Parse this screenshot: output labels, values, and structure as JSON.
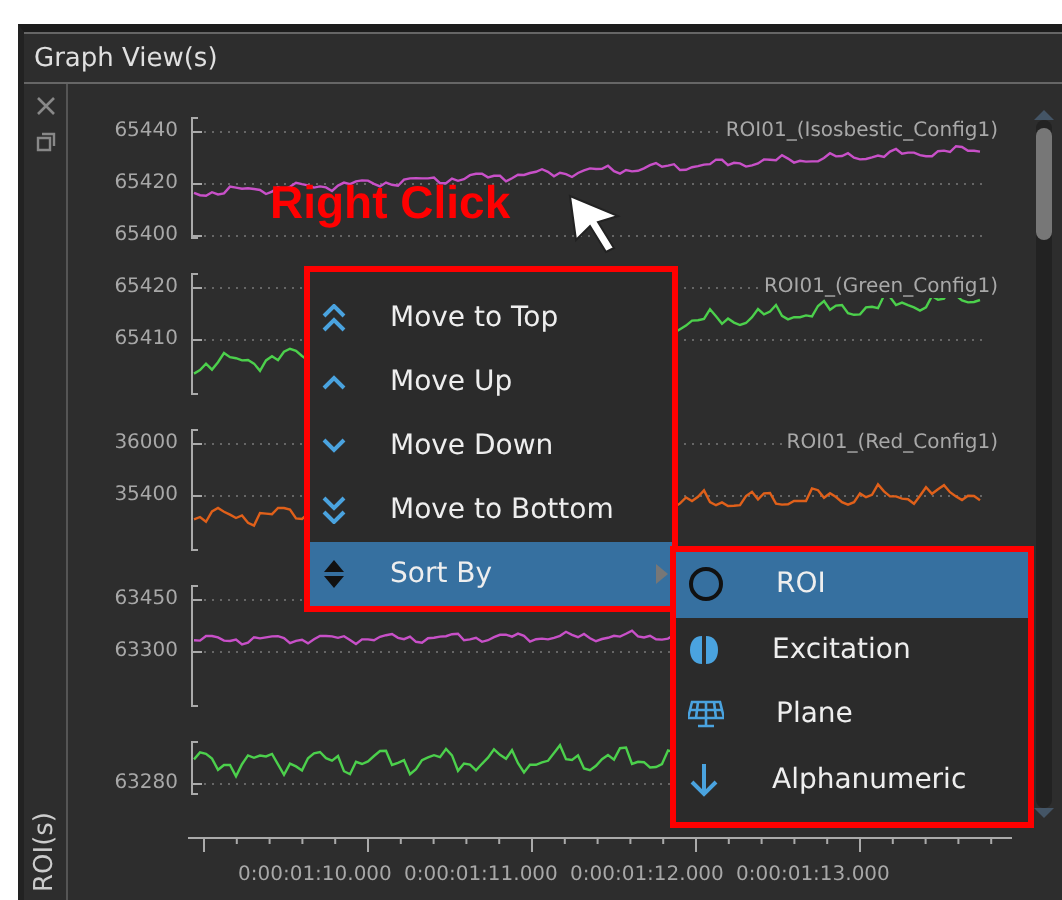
{
  "panel": {
    "title": "Graph View(s)",
    "side_label": "ROI(s)"
  },
  "plots": [
    {
      "label": "ROI01_(Isosbestic_Config1)",
      "color": "#c850c8",
      "ticks": [
        "65440",
        "65420",
        "65400"
      ]
    },
    {
      "label": "ROI01_(Green_Config1)",
      "color": "#4cd04c",
      "ticks": [
        "65420",
        "65410"
      ]
    },
    {
      "label": "ROI01_(Red_Config1)",
      "color": "#e0601a",
      "ticks": [
        "36000",
        "35400"
      ]
    },
    {
      "color": "#c850c8",
      "ticks": [
        "63450",
        "63300"
      ]
    },
    {
      "color": "#4cd04c",
      "ticks": [
        "63280"
      ]
    }
  ],
  "x_ticks": [
    "0:00:01:10.000",
    "0:00:01:11.000",
    "0:00:01:12.000",
    "0:00:01:13.000"
  ],
  "annotation": "Right Click",
  "context_menu": [
    {
      "label": "Move to Top",
      "selected": false,
      "submenu": false
    },
    {
      "label": "Move Up",
      "selected": false,
      "submenu": false
    },
    {
      "label": "Move Down",
      "selected": false,
      "submenu": false
    },
    {
      "label": "Move to Bottom",
      "selected": false,
      "submenu": false
    },
    {
      "label": "Sort By",
      "selected": true,
      "submenu": true
    }
  ],
  "submenu": [
    {
      "label": "ROI",
      "selected": true
    },
    {
      "label": "Excitation",
      "selected": false
    },
    {
      "label": "Plane",
      "selected": false
    },
    {
      "label": "Alphanumeric",
      "selected": false
    }
  ]
}
